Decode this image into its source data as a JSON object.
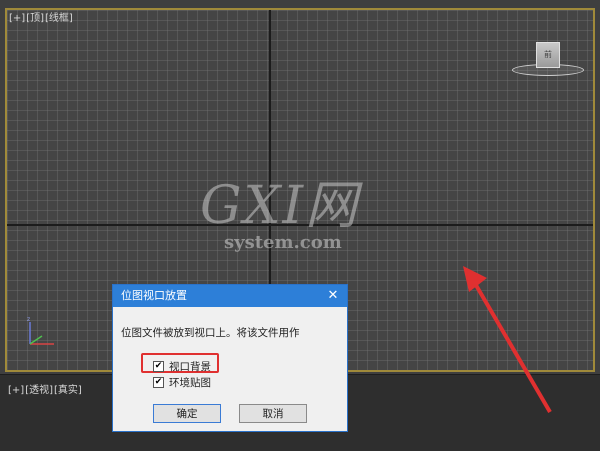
{
  "viewport_top": {
    "label_parts": [
      "[+]",
      "[顶]",
      "[线框]"
    ]
  },
  "viewport_bottom": {
    "label_parts": [
      "[+]",
      "[透视]",
      "[真实]"
    ]
  },
  "viewcube": {
    "face_label": "前"
  },
  "watermark": {
    "big": "GXI网",
    "small": "system.com"
  },
  "dialog": {
    "title": "位图视口放置",
    "close_glyph": "✕",
    "message": "位图文件被放到视口上。将该文件用作",
    "options": [
      {
        "label": "视口背景",
        "checked": true,
        "mark": "✔"
      },
      {
        "label": "环境贴图",
        "checked": true,
        "mark": "✔"
      }
    ],
    "ok_label": "确定",
    "cancel_label": "取消"
  },
  "colors": {
    "viewport_border": "#a08a3a",
    "dialog_title_bar": "#2d7fd8",
    "highlight": "#e03030",
    "arrow": "#e03030"
  }
}
